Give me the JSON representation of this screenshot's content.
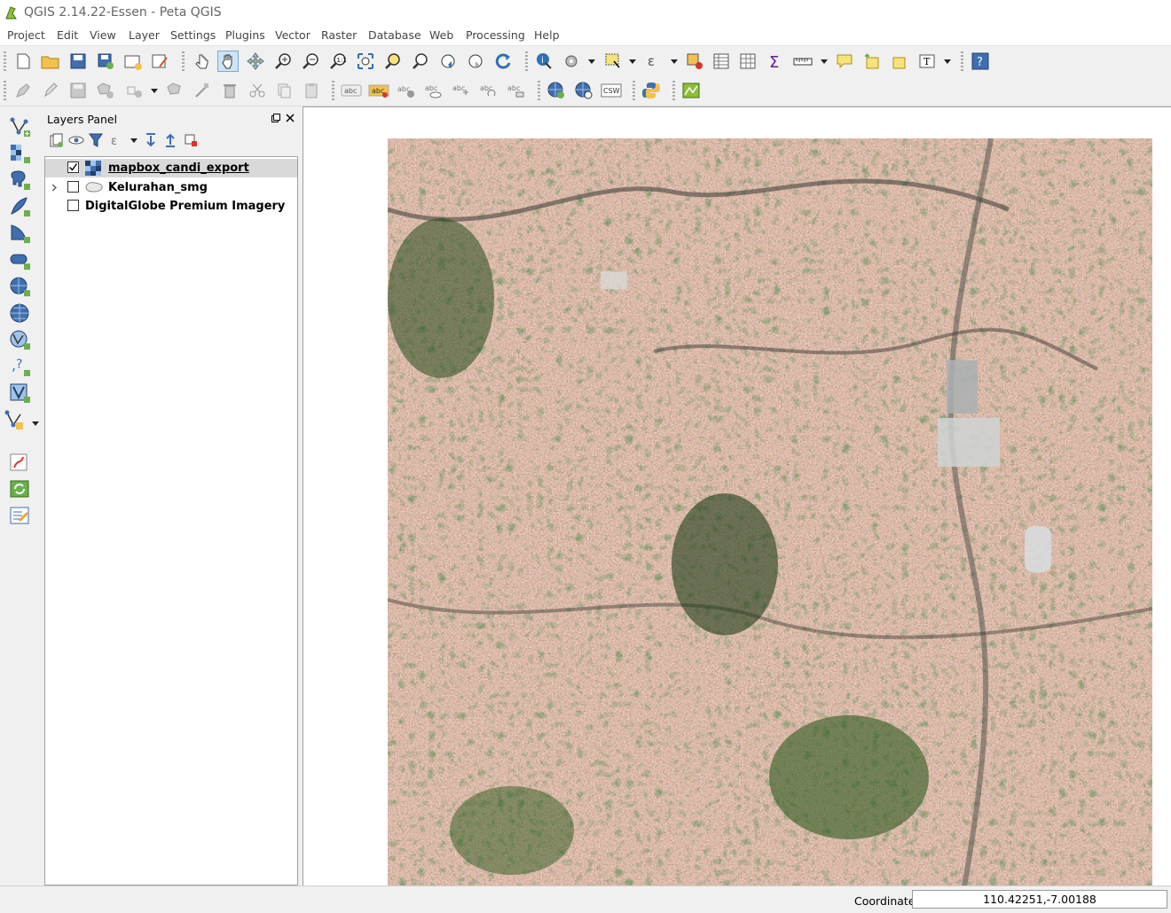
{
  "window": {
    "title": "QGIS 2.14.22-Essen - Peta QGIS"
  },
  "menu": [
    "Project",
    "Edit",
    "View",
    "Layer",
    "Settings",
    "Plugins",
    "Vector",
    "Raster",
    "Database",
    "Web",
    "Processing",
    "Help"
  ],
  "toolbar_labels": {
    "csw": "CSW",
    "abc": "abc"
  },
  "layers_panel": {
    "title": "Layers Panel",
    "layers": [
      {
        "name": "mapbox_candi_export",
        "checked": true,
        "type": "raster"
      },
      {
        "name": "Kelurahan_smg",
        "checked": false,
        "type": "polygon"
      },
      {
        "name": "DigitalGlobe Premium Imagery",
        "checked": false,
        "type": "wms"
      }
    ]
  },
  "status": {
    "coordinate_label": "Coordinate",
    "coordinate_value": "110.42251,-7.00188"
  },
  "colors": {
    "accent": "#2f6fb5",
    "selection": "#d9d9d9"
  }
}
